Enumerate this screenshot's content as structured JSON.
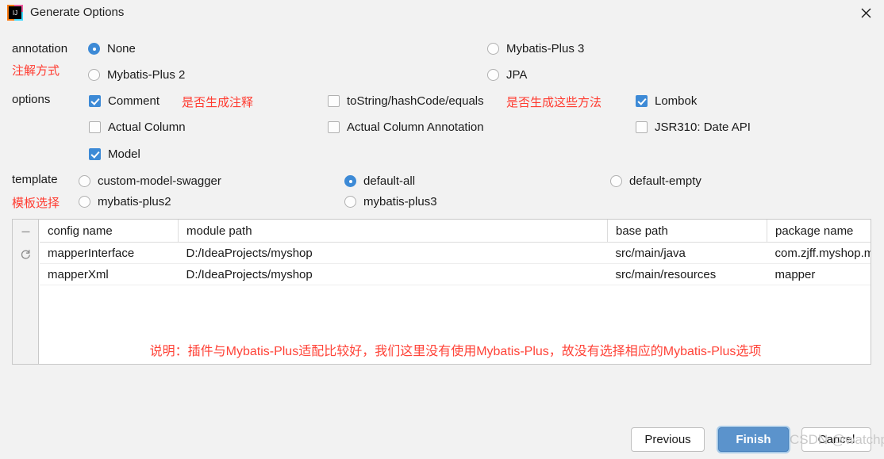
{
  "window": {
    "title": "Generate Options",
    "app_icon": "intellij-idea-icon",
    "close_icon": "close-icon"
  },
  "annotation": {
    "label": "annotation",
    "label_cn": "注解方式",
    "options": [
      {
        "label": "None",
        "checked": true
      },
      {
        "label": "Mybatis-Plus 2",
        "checked": false
      },
      {
        "label": "Mybatis-Plus 3",
        "checked": false
      },
      {
        "label": "JPA",
        "checked": false
      }
    ]
  },
  "options": {
    "label": "options",
    "hint_comment": "是否生成注释",
    "hint_tostring": "是否生成这些方法",
    "items": [
      {
        "label": "Comment",
        "checked": true
      },
      {
        "label": "toString/hashCode/equals",
        "checked": false
      },
      {
        "label": "Lombok",
        "checked": true
      },
      {
        "label": "Actual Column",
        "checked": false
      },
      {
        "label": "Actual Column Annotation",
        "checked": false
      },
      {
        "label": "JSR310: Date API",
        "checked": false
      },
      {
        "label": "Model",
        "checked": true
      }
    ]
  },
  "template": {
    "label": "template",
    "label_cn": "模板选择",
    "options": [
      {
        "label": "custom-model-swagger",
        "checked": false
      },
      {
        "label": "default-all",
        "checked": true
      },
      {
        "label": "default-empty",
        "checked": false
      },
      {
        "label": "mybatis-plus2",
        "checked": false
      },
      {
        "label": "mybatis-plus3",
        "checked": false
      }
    ]
  },
  "table": {
    "gutter": {
      "remove_icon": "minus-icon",
      "reset_icon": "refresh-icon"
    },
    "headers": [
      "config name",
      "module path",
      "base path",
      "package name"
    ],
    "rows": [
      {
        "config_name": "mapperInterface",
        "module_path": "D:/IdeaProjects/myshop",
        "base_path": "src/main/java",
        "package_name": "com.zjff.myshop.mapp"
      },
      {
        "config_name": "mapperXml",
        "module_path": "D:/IdeaProjects/myshop",
        "base_path": "src/main/resources",
        "package_name": "mapper"
      }
    ],
    "note": "说明：插件与Mybatis-Plus适配比较好，我们这里没有使用Mybatis-Plus，故没有选择相应的Mybatis-Plus选项"
  },
  "footer": {
    "previous": "Previous",
    "finish": "Finish",
    "cancel": "Cancel"
  },
  "watermark": "CSDN @watchping",
  "colors": {
    "accent": "#3d8ad6",
    "primary_button": "#5b93cc",
    "red_note": "#ff4338",
    "dialog_bg": "#f2f2f2"
  }
}
